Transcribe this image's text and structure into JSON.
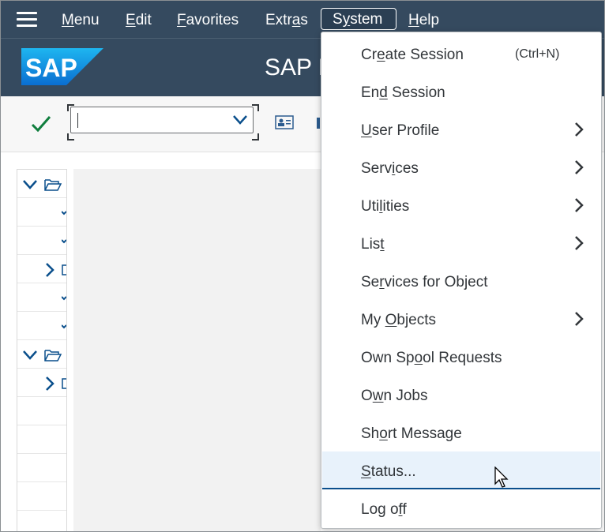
{
  "menubar": {
    "items": [
      {
        "pre": "",
        "u": "M",
        "post": "enu"
      },
      {
        "pre": "",
        "u": "E",
        "post": "dit"
      },
      {
        "pre": "",
        "u": "F",
        "post": "avorites"
      },
      {
        "pre": "Extr",
        "u": "a",
        "post": "s"
      },
      {
        "pre": "S",
        "u": "y",
        "post": "stem"
      },
      {
        "pre": "",
        "u": "H",
        "post": "elp"
      }
    ]
  },
  "header": {
    "logo_text": "SAP",
    "title": "SAP E"
  },
  "toolbar": {
    "command_value": ""
  },
  "system_menu": {
    "items": [
      {
        "pre": "Cr",
        "u": "e",
        "post": "ate Session",
        "shortcut": "(Ctrl+N)"
      },
      {
        "pre": "En",
        "u": "d",
        "post": " Session"
      },
      {
        "pre": "",
        "u": "U",
        "post": "ser Profile"
      },
      {
        "pre": "Serv",
        "u": "i",
        "post": "ces"
      },
      {
        "pre": "Uti",
        "u": "l",
        "post": "ities"
      },
      {
        "pre": "Lis",
        "u": "t",
        "post": ""
      },
      {
        "pre": "Se",
        "u": "r",
        "post": "vices for Object"
      },
      {
        "pre": "My ",
        "u": "O",
        "post": "bjects"
      },
      {
        "pre": "Own Sp",
        "u": "o",
        "post": "ol Requests"
      },
      {
        "pre": "O",
        "u": "w",
        "post": "n Jobs"
      },
      {
        "pre": "Sh",
        "u": "o",
        "post": "rt Message"
      },
      {
        "pre": "",
        "u": "S",
        "post": "tatus..."
      },
      {
        "pre": "Log o",
        "u": "f",
        "post": "f"
      }
    ]
  },
  "colors": {
    "shell": "#354a5f",
    "accent": "#0a6ed1",
    "hover": "#e8f2fb",
    "check": "#107e3e"
  }
}
